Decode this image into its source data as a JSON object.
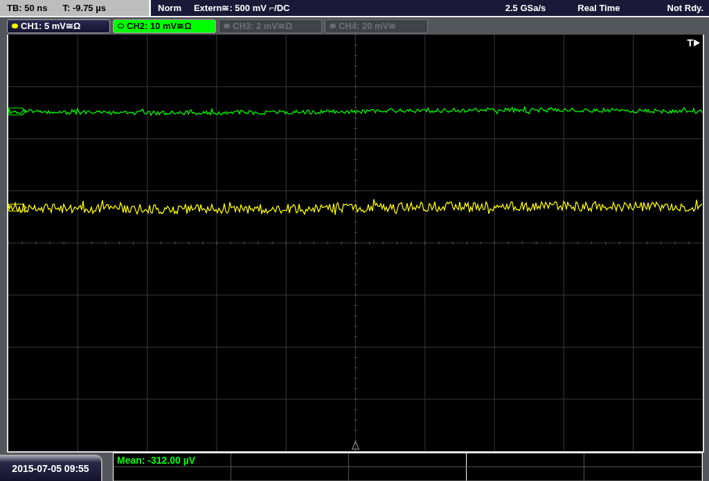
{
  "status_bar": {
    "timebase": "TB: 50 ns",
    "trigger_time": "T: -9.75 µs",
    "mode": "Norm",
    "trigger_source": "Extern≅: 500 mV ⌐/DC",
    "sample_rate": "2.5 GSa/s",
    "acquisition": "Real Time",
    "state": "Not Rdy."
  },
  "channels": [
    {
      "label": "CH1: 5 mV≅Ω",
      "selected": false,
      "on": true,
      "color": "#ffff00"
    },
    {
      "label": "CH2: 10 mV≅Ω",
      "selected": true,
      "on": true,
      "color": "#00ff00"
    },
    {
      "label": "CH3: 2 mV≅Ω",
      "selected": false,
      "on": false,
      "color": "#6a6d70"
    },
    {
      "label": "CH4: 20 mV≅",
      "selected": false,
      "on": false,
      "color": "#6a6d70"
    }
  ],
  "trigger_label": "T",
  "measurements": [
    {
      "text": "Mean: -312.00 µV"
    }
  ],
  "date": "2015-07-05 09:55"
}
